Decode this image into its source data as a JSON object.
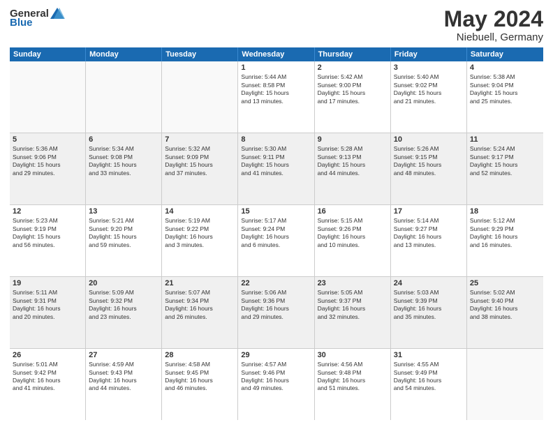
{
  "header": {
    "logo_general": "General",
    "logo_blue": "Blue",
    "title": "May 2024",
    "subtitle": "Niebuell, Germany"
  },
  "calendar": {
    "days_of_week": [
      "Sunday",
      "Monday",
      "Tuesday",
      "Wednesday",
      "Thursday",
      "Friday",
      "Saturday"
    ],
    "weeks": [
      [
        {
          "day": "",
          "content": ""
        },
        {
          "day": "",
          "content": ""
        },
        {
          "day": "",
          "content": ""
        },
        {
          "day": "1",
          "content": "Sunrise: 5:44 AM\nSunset: 8:58 PM\nDaylight: 15 hours\nand 13 minutes."
        },
        {
          "day": "2",
          "content": "Sunrise: 5:42 AM\nSunset: 9:00 PM\nDaylight: 15 hours\nand 17 minutes."
        },
        {
          "day": "3",
          "content": "Sunrise: 5:40 AM\nSunset: 9:02 PM\nDaylight: 15 hours\nand 21 minutes."
        },
        {
          "day": "4",
          "content": "Sunrise: 5:38 AM\nSunset: 9:04 PM\nDaylight: 15 hours\nand 25 minutes."
        }
      ],
      [
        {
          "day": "5",
          "content": "Sunrise: 5:36 AM\nSunset: 9:06 PM\nDaylight: 15 hours\nand 29 minutes."
        },
        {
          "day": "6",
          "content": "Sunrise: 5:34 AM\nSunset: 9:08 PM\nDaylight: 15 hours\nand 33 minutes."
        },
        {
          "day": "7",
          "content": "Sunrise: 5:32 AM\nSunset: 9:09 PM\nDaylight: 15 hours\nand 37 minutes."
        },
        {
          "day": "8",
          "content": "Sunrise: 5:30 AM\nSunset: 9:11 PM\nDaylight: 15 hours\nand 41 minutes."
        },
        {
          "day": "9",
          "content": "Sunrise: 5:28 AM\nSunset: 9:13 PM\nDaylight: 15 hours\nand 44 minutes."
        },
        {
          "day": "10",
          "content": "Sunrise: 5:26 AM\nSunset: 9:15 PM\nDaylight: 15 hours\nand 48 minutes."
        },
        {
          "day": "11",
          "content": "Sunrise: 5:24 AM\nSunset: 9:17 PM\nDaylight: 15 hours\nand 52 minutes."
        }
      ],
      [
        {
          "day": "12",
          "content": "Sunrise: 5:23 AM\nSunset: 9:19 PM\nDaylight: 15 hours\nand 56 minutes."
        },
        {
          "day": "13",
          "content": "Sunrise: 5:21 AM\nSunset: 9:20 PM\nDaylight: 15 hours\nand 59 minutes."
        },
        {
          "day": "14",
          "content": "Sunrise: 5:19 AM\nSunset: 9:22 PM\nDaylight: 16 hours\nand 3 minutes."
        },
        {
          "day": "15",
          "content": "Sunrise: 5:17 AM\nSunset: 9:24 PM\nDaylight: 16 hours\nand 6 minutes."
        },
        {
          "day": "16",
          "content": "Sunrise: 5:15 AM\nSunset: 9:26 PM\nDaylight: 16 hours\nand 10 minutes."
        },
        {
          "day": "17",
          "content": "Sunrise: 5:14 AM\nSunset: 9:27 PM\nDaylight: 16 hours\nand 13 minutes."
        },
        {
          "day": "18",
          "content": "Sunrise: 5:12 AM\nSunset: 9:29 PM\nDaylight: 16 hours\nand 16 minutes."
        }
      ],
      [
        {
          "day": "19",
          "content": "Sunrise: 5:11 AM\nSunset: 9:31 PM\nDaylight: 16 hours\nand 20 minutes."
        },
        {
          "day": "20",
          "content": "Sunrise: 5:09 AM\nSunset: 9:32 PM\nDaylight: 16 hours\nand 23 minutes."
        },
        {
          "day": "21",
          "content": "Sunrise: 5:07 AM\nSunset: 9:34 PM\nDaylight: 16 hours\nand 26 minutes."
        },
        {
          "day": "22",
          "content": "Sunrise: 5:06 AM\nSunset: 9:36 PM\nDaylight: 16 hours\nand 29 minutes."
        },
        {
          "day": "23",
          "content": "Sunrise: 5:05 AM\nSunset: 9:37 PM\nDaylight: 16 hours\nand 32 minutes."
        },
        {
          "day": "24",
          "content": "Sunrise: 5:03 AM\nSunset: 9:39 PM\nDaylight: 16 hours\nand 35 minutes."
        },
        {
          "day": "25",
          "content": "Sunrise: 5:02 AM\nSunset: 9:40 PM\nDaylight: 16 hours\nand 38 minutes."
        }
      ],
      [
        {
          "day": "26",
          "content": "Sunrise: 5:01 AM\nSunset: 9:42 PM\nDaylight: 16 hours\nand 41 minutes."
        },
        {
          "day": "27",
          "content": "Sunrise: 4:59 AM\nSunset: 9:43 PM\nDaylight: 16 hours\nand 44 minutes."
        },
        {
          "day": "28",
          "content": "Sunrise: 4:58 AM\nSunset: 9:45 PM\nDaylight: 16 hours\nand 46 minutes."
        },
        {
          "day": "29",
          "content": "Sunrise: 4:57 AM\nSunset: 9:46 PM\nDaylight: 16 hours\nand 49 minutes."
        },
        {
          "day": "30",
          "content": "Sunrise: 4:56 AM\nSunset: 9:48 PM\nDaylight: 16 hours\nand 51 minutes."
        },
        {
          "day": "31",
          "content": "Sunrise: 4:55 AM\nSunset: 9:49 PM\nDaylight: 16 hours\nand 54 minutes."
        },
        {
          "day": "",
          "content": ""
        }
      ]
    ]
  }
}
